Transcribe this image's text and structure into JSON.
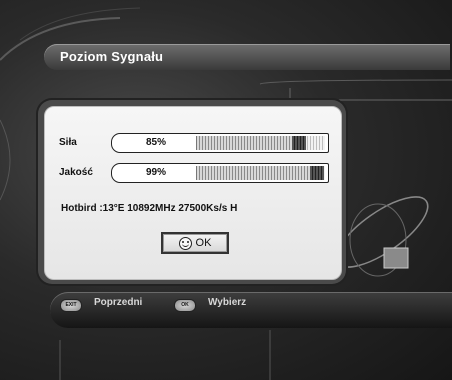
{
  "header": {
    "title": "Poziom Sygnału"
  },
  "meters": [
    {
      "label": "Siła",
      "value_text": "85%",
      "level": 0.85
    },
    {
      "label": "Jakość",
      "value_text": "99%",
      "level": 0.99
    }
  ],
  "transponder": {
    "info": "Hotbird :13°E  10892MHz 27500Ks/s H"
  },
  "ok_button": {
    "label": "OK",
    "icon": "smiley-icon"
  },
  "footer": {
    "keys": [
      {
        "key": "EXIT",
        "label": "Poprzedni"
      },
      {
        "key": "OK",
        "label": "Wybierz"
      }
    ]
  },
  "colors": {
    "panel": "#f0f0f0",
    "title_bar": "#5a5a5a",
    "background": "#2a2a2a"
  }
}
